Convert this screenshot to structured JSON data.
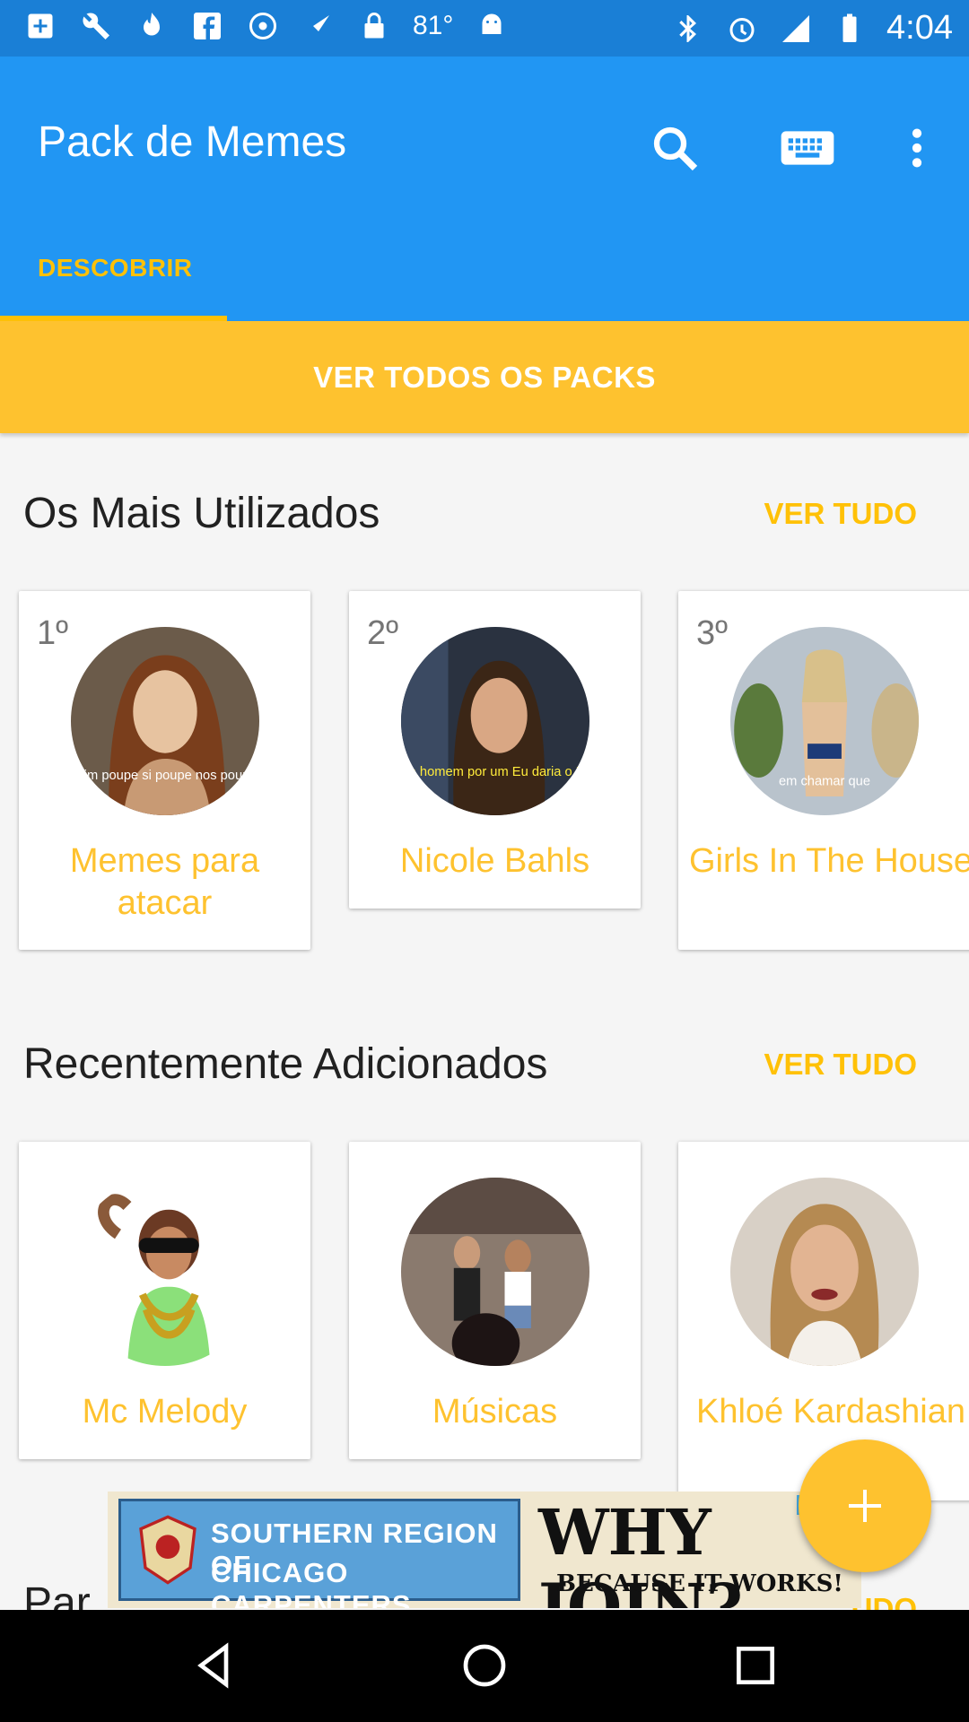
{
  "status_bar": {
    "icons": [
      "medical-plus-icon",
      "wrench-icon",
      "flame-icon",
      "facebook-icon",
      "settings-dot-icon",
      "fake-gps-icon",
      "lock-icon",
      "android-icon"
    ],
    "temperature": "81°",
    "right_icons": [
      "bluetooth-icon",
      "alarm-icon",
      "signal-icon",
      "battery-icon"
    ],
    "time": "4:04"
  },
  "toolbar": {
    "title": "Pack de Memes",
    "actions": [
      "search-icon",
      "keyboard-icon",
      "more-vert-icon"
    ]
  },
  "tabs": [
    {
      "label": "DESCOBRIR",
      "selected": true
    }
  ],
  "banner": {
    "label": "VER TODOS OS PACKS"
  },
  "sections": {
    "most_used": {
      "title": "Os Mais Utilizados",
      "see_all": "VER TUDO",
      "cards": [
        {
          "rank": "1º",
          "label": "Memes para atacar",
          "caption": "mim poupe si poupe nos poupe"
        },
        {
          "rank": "2º",
          "label": "Nicole Bahls",
          "caption": "fosse homem por um Eu daria o Eddy"
        },
        {
          "rank": "3º",
          "label": "Girls In The House",
          "caption": "em chamar que"
        }
      ]
    },
    "recent": {
      "title": "Recentemente Adicionados",
      "see_all": "VER TUDO",
      "cards": [
        {
          "label": "Mc Melody"
        },
        {
          "label": "Músicas"
        },
        {
          "label": "Khloé Kardashian"
        }
      ]
    },
    "next_partial": {
      "title": "Par",
      "see_all": "UDO"
    }
  },
  "ad": {
    "line1": "SOUTHERN REGION OF",
    "line2": "CHICAGO CARPENTERS",
    "headline": "WHY JOIN?",
    "tagline": "BECAUSE IT WORKS!"
  },
  "fab": {
    "icon": "plus-icon"
  },
  "nav": [
    "back-icon",
    "home-icon",
    "recents-icon"
  ],
  "colors": {
    "primary": "#2196f3",
    "primary_dark": "#1a7fd6",
    "accent": "#fec22f",
    "accent_text": "#ffc107"
  }
}
